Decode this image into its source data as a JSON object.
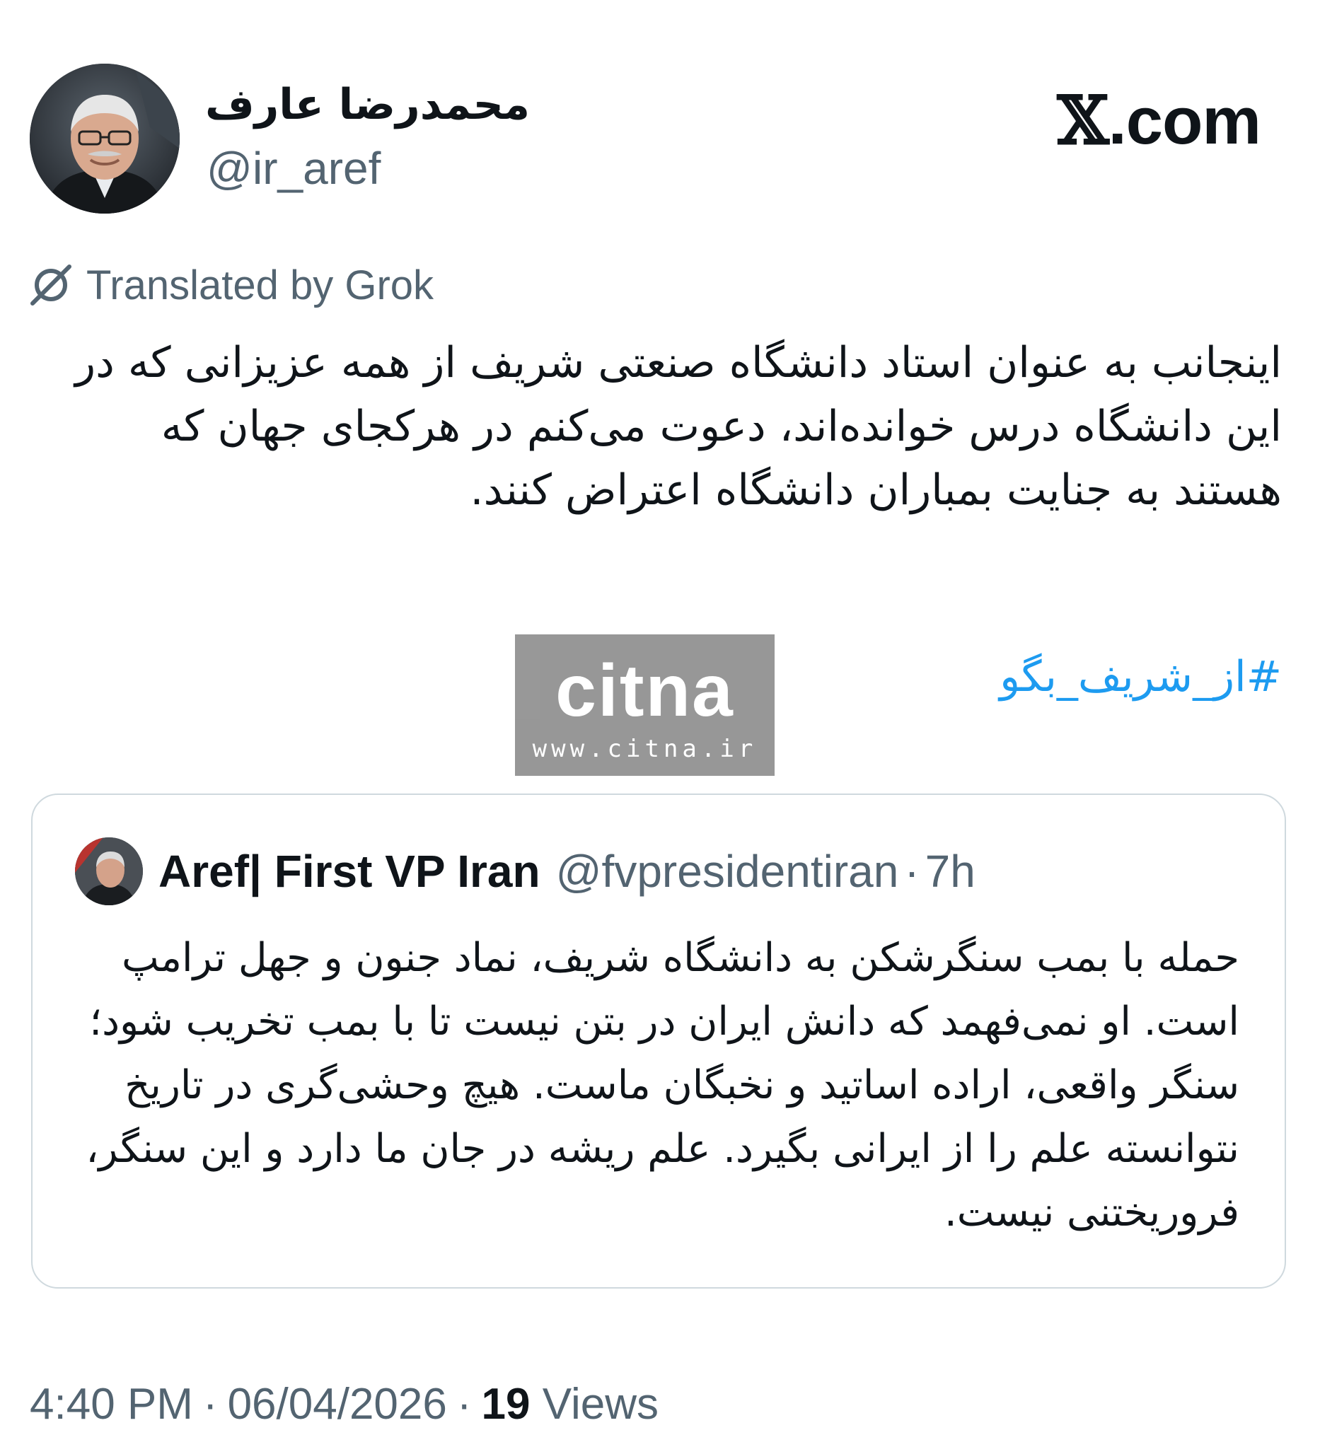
{
  "author": {
    "display_name": "محمدرضا عارف",
    "handle": "@ir_aref"
  },
  "site_mark": {
    "x": "𝕏",
    "rest": ".com"
  },
  "translation": {
    "label": "Translated by Grok",
    "icon": "grok-icon"
  },
  "tweet": {
    "text": "اینجانب به عنوان استاد دانشگاه صنعتی شریف از همه عزیزانی که در این دانشگاه درس خوانده‌اند، دعوت می‌کنم در هرکجای جهان که هستند به جنایت بمباران دانشگاه اعتراض کنند.",
    "hashtag": "#از_شریف_بگو"
  },
  "watermark": {
    "logo": "citna",
    "url": "www.citna.ir"
  },
  "quote": {
    "name": "Aref| First VP Iran",
    "handle": "@fvpresidentiran",
    "separator": "·",
    "time": "7h",
    "text": "حمله با بمب سنگرشکن به دانشگاه شریف، نماد جنون و جهل ترامپ است. او نمی‌فهمد که دانش ایران در بتن نیست تا با بمب تخریب شود؛ سنگر واقعی، اراده اساتید و نخبگان ماست. هیچ وحشی‌گری  در تاریخ نتوانسته علم را از ایرانی بگیرد. علم ریشه در جان ما دارد و این سنگر، فروریختنی نیست."
  },
  "meta": {
    "time": "4:40 PM",
    "separator": "·",
    "date": "06/04/2026",
    "views_count": "19",
    "views_label": "Views"
  },
  "colors": {
    "text": "#0f1419",
    "secondary": "#536471",
    "link": "#1d9bf0",
    "border": "#cfd9de"
  }
}
